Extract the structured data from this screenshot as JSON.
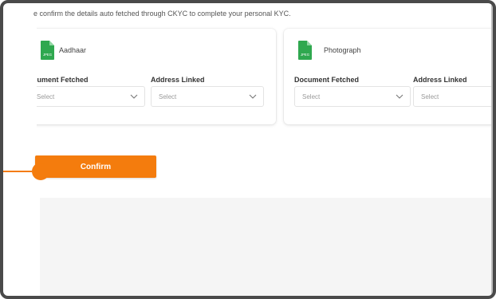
{
  "intro_text": "e confirm the details auto fetched through CKYC to complete your personal KYC.",
  "cards": [
    {
      "title": "Aadhaar",
      "icon": "jpeg-file-icon",
      "fields": [
        {
          "label": "ocument Fetched",
          "placeholder": "Select"
        },
        {
          "label": "Address Linked",
          "placeholder": "Select"
        }
      ]
    },
    {
      "title": "Photograph",
      "icon": "jpeg-file-icon",
      "fields": [
        {
          "label": "Document Fetched",
          "placeholder": "Select"
        },
        {
          "label": "Address Linked",
          "placeholder": "Select"
        }
      ]
    }
  ],
  "confirm_label": "Confirm",
  "file_badge": "JPEG",
  "colors": {
    "accent": "#f47c0d",
    "icon_green": "#2fa84f"
  }
}
